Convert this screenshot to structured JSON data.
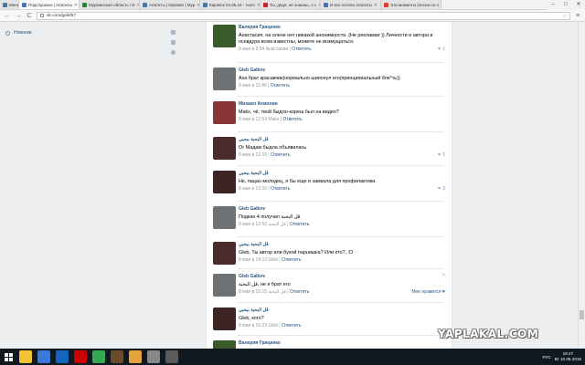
{
  "browser": {
    "tabs": [
      {
        "label": "Меню",
        "color": "#4a76a8"
      },
      {
        "label": "Подслушано | Апатиты",
        "color": "#4a76a8"
      },
      {
        "label": "Мурманская область / Е",
        "color": "#2e7d32"
      },
      {
        "label": "Апатиты | Кировск | Мур",
        "color": "#4a76a8"
      },
      {
        "label": "Кировск 04.05.16 - тыло",
        "color": "#4a76a8"
      },
      {
        "label": "Ты, дядя, не знаешь, о с",
        "color": "#c62828"
      },
      {
        "label": "И все хотели Апатиты",
        "color": "#4a76a8"
      },
      {
        "label": "Эти моменты (песни но о",
        "color": "#e53935"
      }
    ],
    "window_controls": {
      "minimize": "–",
      "maximize": "□",
      "close": "✕"
    },
    "url": "vk.com/gelsf57",
    "nav": {
      "back": "←",
      "forward": "→",
      "reload": "C"
    },
    "menu_glyph": "≡",
    "star_glyph": "☆"
  },
  "sidebar": {
    "item_label": "Новинки"
  },
  "comments": [
    {
      "author": "Валерия Гриценко",
      "text": "Анастасия, на олене нет никакой анонимности. (Не рекламая )) Личности и автора и псевдура всем известны, можете не возмущаться.",
      "date": "8 мая в 9:54 Анастасии",
      "reply": "Ответить",
      "likes": "1",
      "avatar_color": "#3b5a2a"
    },
    {
      "author": "Gleb Galkov",
      "text": "Аха брат красавчик(нормально шипонул его(принципиальный бле*ть))",
      "date": "8 мая в 11:46",
      "reply": "Ответить",
      "likes": "",
      "avatar_color": "#6d7277"
    },
    {
      "author": "Михаил Ахмолин",
      "text": "Maks, чё, твой быдло-кореш был на видео?",
      "date": "8 мая в 12:54 Maks",
      "reply": "Ответить",
      "likes": "",
      "avatar_color": "#8a3535"
    },
    {
      "author": "ڤل البحبة ببحبي",
      "text": "Ог Мадам быдла объявилась",
      "date": "8 мая в 13:10",
      "reply": "Ответить",
      "likes": "1",
      "avatar_color": "#4a2a2a"
    },
    {
      "author": "ڤل البحبة ببحبي",
      "text": "Не, пацан молодец, я бы еще и замкала для профилактики.",
      "date": "8 мая в 13:10",
      "reply": "Ответить",
      "likes": "3",
      "avatar_color": "#3d2424"
    },
    {
      "author": "Gleb Galkov",
      "text": "Подкан 4 получил ڤل البحبة",
      "date": "8 мая в 13:53 ڤل البحبة",
      "reply": "Ответить",
      "likes": "",
      "avatar_color": "#6d7277"
    },
    {
      "author": "ڤل البحبة ببحبي",
      "text": "Gleb, Ты автор или бухой парнишка? Или кто?..:D",
      "date": "8 мая в 14:12 Gleb",
      "reply": "Ответить",
      "likes": "",
      "avatar_color": "#4a2a2a"
    },
    {
      "author": "Gleb Galkov",
      "text": "ڤل البحبة, не я брат его",
      "date": "8 мая в 15:15 ڤل البحبة",
      "reply": "Ответить",
      "likes": "",
      "like_me": "Мне нравится ♥",
      "avatar_color": "#6d7277"
    },
    {
      "author": "ڤل البحبة ببحبي",
      "text": "Gleb, кого?",
      "date": "8 мая в 15:23 Gleb",
      "reply": "Ответить",
      "likes": "",
      "avatar_color": "#3d2424"
    },
    {
      "author": "Валерия Гриценко",
      "text": "",
      "date": "",
      "reply": "",
      "likes": "",
      "avatar_color": "#3b5a2a"
    }
  ],
  "like_glyph": "♥",
  "close_glyph": "✕",
  "watermark": "YAPLAKAL.COM",
  "taskbar": {
    "apps": [
      {
        "icon": "windows-start-icon",
        "color": "#ffffff"
      },
      {
        "icon": "file-explorer-icon",
        "color": "#f1c232"
      },
      {
        "icon": "store-icon",
        "color": "#3c78d8"
      },
      {
        "icon": "mail-icon",
        "color": "#1565c0"
      },
      {
        "icon": "opera-icon",
        "color": "#cc0000"
      },
      {
        "icon": "chrome-icon",
        "color": "#34a853"
      },
      {
        "icon": "game-icon",
        "color": "#6a4c2a"
      },
      {
        "icon": "folder-icon",
        "color": "#e6a23c"
      },
      {
        "icon": "settings-icon",
        "color": "#888888"
      },
      {
        "icon": "media-icon",
        "color": "#5b5b5b"
      }
    ],
    "language": "РУС",
    "time": "19:47",
    "date": "Вт 10.05.2016"
  }
}
